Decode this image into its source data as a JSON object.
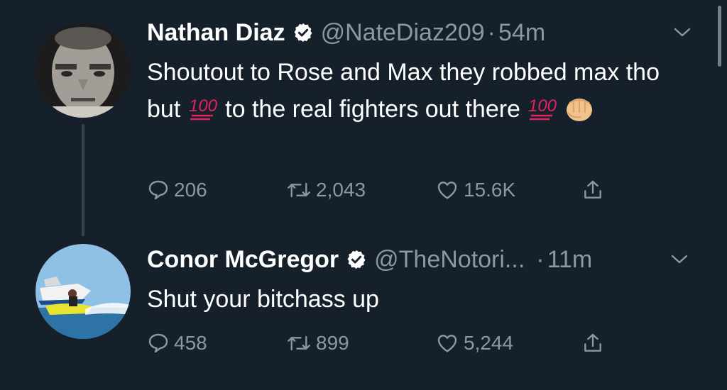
{
  "tweets": [
    {
      "author": {
        "name": "Nathan Diaz",
        "handle": "@NateDiaz209",
        "verified": true
      },
      "separator": "·",
      "time": "54m",
      "text": {
        "part1": "Shoutout to Rose and Max they robbed max tho but ",
        "part2": " to the real fighters out there "
      },
      "emojis": [
        "hundred-points",
        "hundred-points",
        "oncoming-fist"
      ],
      "stats": {
        "replies": "206",
        "retweets": "2,043",
        "likes": "15.6K"
      }
    },
    {
      "author": {
        "name": "Conor McGregor",
        "handle": "@TheNotori...",
        "verified": true
      },
      "separator": "·",
      "time": "11m",
      "text": {
        "part1": "Shut your bitchass up"
      },
      "stats": {
        "replies": "458",
        "retweets": "899",
        "likes": "5,244"
      }
    }
  ],
  "colors": {
    "background": "#15202b",
    "secondary_text": "#8899a6",
    "thread_line": "#38444d",
    "verified_badge": "#ffffff",
    "emoji_100_red": "#e0245e"
  }
}
